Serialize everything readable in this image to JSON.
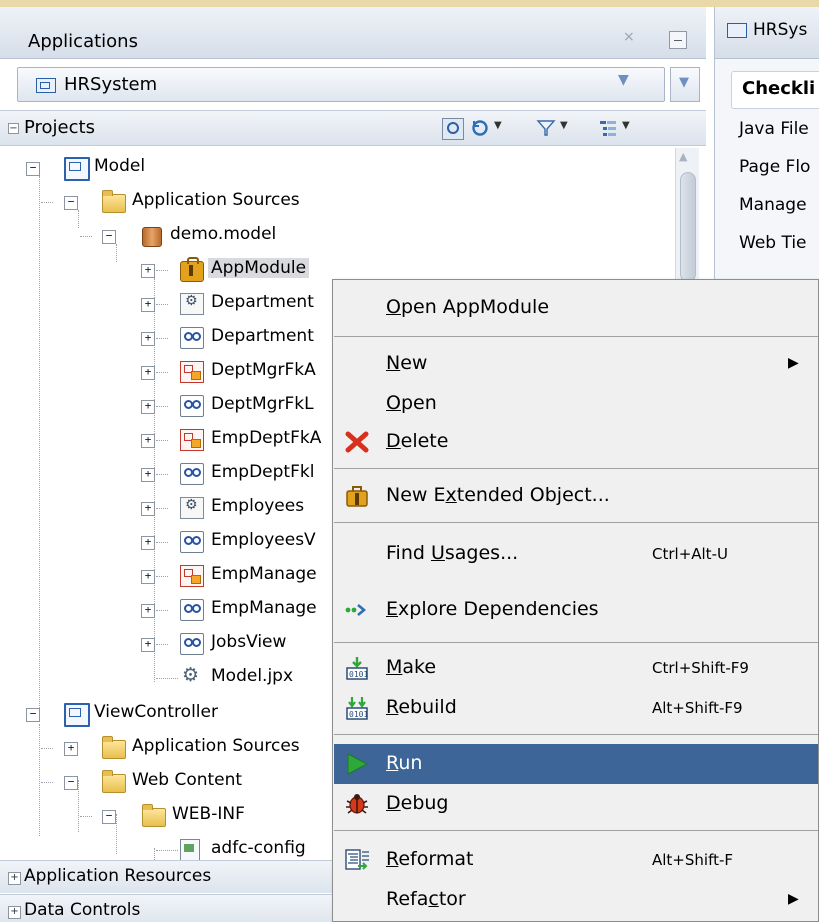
{
  "navigator": {
    "title": "Applications",
    "close_glyph": "×",
    "application_selector": {
      "value": "HRSystem",
      "caret": "▼"
    },
    "projects_label": "Projects",
    "tree": [
      {
        "label": "Model",
        "icon": "project-icon"
      },
      {
        "label": "Application Sources",
        "icon": "folder-icon"
      },
      {
        "label": "demo.model",
        "icon": "package-icon"
      },
      {
        "label": "AppModule",
        "icon": "application-module-icon"
      },
      {
        "label": "Department",
        "icon": "entity-object-icon"
      },
      {
        "label": "Department",
        "icon": "view-object-icon"
      },
      {
        "label": "DeptMgrFkA",
        "icon": "association-icon"
      },
      {
        "label": "DeptMgrFkL",
        "icon": "view-link-icon"
      },
      {
        "label": "EmpDeptFkA",
        "icon": "association-icon"
      },
      {
        "label": "EmpDeptFkl",
        "icon": "view-link-icon"
      },
      {
        "label": "Employees",
        "icon": "entity-object-icon"
      },
      {
        "label": "EmployeesV",
        "icon": "view-object-icon"
      },
      {
        "label": "EmpManage",
        "icon": "association-icon"
      },
      {
        "label": "EmpManage",
        "icon": "view-link-icon"
      },
      {
        "label": "JobsView",
        "icon": "view-object-icon"
      },
      {
        "label": "Model.jpx",
        "icon": "project-file-icon"
      },
      {
        "label": "ViewController",
        "icon": "project-icon"
      },
      {
        "label": "Application Sources",
        "icon": "folder-icon"
      },
      {
        "label": "Web Content",
        "icon": "folder-icon"
      },
      {
        "label": "WEB-INF",
        "icon": "folder-icon"
      },
      {
        "label": "adfc-config",
        "icon": "xml-file-icon"
      }
    ],
    "accordions": [
      "Application Resources",
      "Data Controls"
    ]
  },
  "editor": {
    "tab_label": "HRSys",
    "heading": "Checkli",
    "items": [
      "Java File",
      "Page Flo",
      "Manage",
      "Web Tie"
    ]
  },
  "context_menu": {
    "items": [
      {
        "pre": "",
        "u": "O",
        "post": "pen AppModule",
        "shortcut": "",
        "submenu": false,
        "icon": ""
      },
      {
        "pre": "",
        "u": "N",
        "post": "ew",
        "shortcut": "",
        "submenu": true,
        "icon": ""
      },
      {
        "pre": "",
        "u": "O",
        "post": "pen",
        "shortcut": "",
        "submenu": false,
        "icon": ""
      },
      {
        "pre": "",
        "u": "D",
        "post": "elete",
        "shortcut": "",
        "submenu": false,
        "icon": "delete-icon"
      },
      {
        "pre": "New E",
        "u": "x",
        "post": "tended Object...",
        "shortcut": "",
        "submenu": false,
        "icon": "application-module-icon"
      },
      {
        "pre": "Find ",
        "u": "U",
        "post": "sages...",
        "shortcut": "Ctrl+Alt-U",
        "submenu": false,
        "icon": ""
      },
      {
        "pre": "",
        "u": "E",
        "post": "xplore Dependencies",
        "shortcut": "",
        "submenu": false,
        "icon": "dependencies-icon"
      },
      {
        "pre": "",
        "u": "M",
        "post": "ake",
        "shortcut": "Ctrl+Shift-F9",
        "submenu": false,
        "icon": "make-icon"
      },
      {
        "pre": "",
        "u": "R",
        "post": "ebuild",
        "shortcut": "Alt+Shift-F9",
        "submenu": false,
        "icon": "rebuild-icon"
      },
      {
        "pre": "",
        "u": "R",
        "post": "un",
        "shortcut": "",
        "submenu": false,
        "icon": "run-icon",
        "highlighted": true
      },
      {
        "pre": "",
        "u": "D",
        "post": "ebug",
        "shortcut": "",
        "submenu": false,
        "icon": "debug-icon"
      },
      {
        "pre": "",
        "u": "R",
        "post": "eformat",
        "shortcut": "Alt+Shift-F",
        "submenu": false,
        "icon": "reformat-icon"
      },
      {
        "pre": "Refa",
        "u": "c",
        "post": "tor",
        "shortcut": "",
        "submenu": true,
        "icon": ""
      }
    ],
    "submenu_glyph": "▶"
  },
  "colors": {
    "menu_highlight": "#3d6598",
    "delete_red": "#d9301e",
    "run_green": "#2fa83a"
  }
}
